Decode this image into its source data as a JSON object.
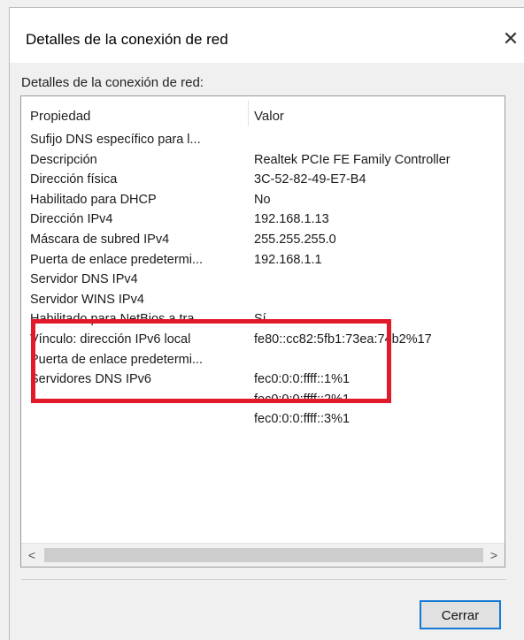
{
  "window": {
    "title": "Detalles de la conexión de red",
    "close_glyph": "✕"
  },
  "group_label": "Detalles de la conexión de red:",
  "list": {
    "headers": {
      "property": "Propiedad",
      "value": "Valor"
    },
    "rows": [
      {
        "property": "Sufijo DNS específico para l...",
        "value": ""
      },
      {
        "property": "Descripción",
        "value": "Realtek PCIe FE Family Controller"
      },
      {
        "property": "Dirección física",
        "value": "3C-52-82-49-E7-B4"
      },
      {
        "property": "Habilitado para DHCP",
        "value": "No"
      },
      {
        "property": "Dirección IPv4",
        "value": "192.168.1.13"
      },
      {
        "property": "Máscara de subred IPv4",
        "value": "255.255.255.0"
      },
      {
        "property": "Puerta de enlace predetermi...",
        "value": "192.168.1.1"
      },
      {
        "property": "Servidor DNS IPv4",
        "value": ""
      },
      {
        "property": "Servidor WINS IPv4",
        "value": ""
      },
      {
        "property": "Habilitado para NetBios a tra...",
        "value": "Sí"
      },
      {
        "property": "Vínculo: dirección IPv6 local",
        "value": "fe80::cc82:5fb1:73ea:74b2%17"
      },
      {
        "property": "Puerta de enlace predetermi...",
        "value": ""
      },
      {
        "property": "Servidores DNS IPv6",
        "value": "fec0:0:0:ffff::1%1"
      },
      {
        "property": "",
        "value": "fec0:0:0:ffff::2%1"
      },
      {
        "property": "",
        "value": "fec0:0:0:ffff::3%1"
      }
    ],
    "highlight_color": "#e0192b"
  },
  "scrollbar": {
    "left_arrow": "<",
    "right_arrow": ">"
  },
  "buttons": {
    "close_label": "Cerrar"
  }
}
